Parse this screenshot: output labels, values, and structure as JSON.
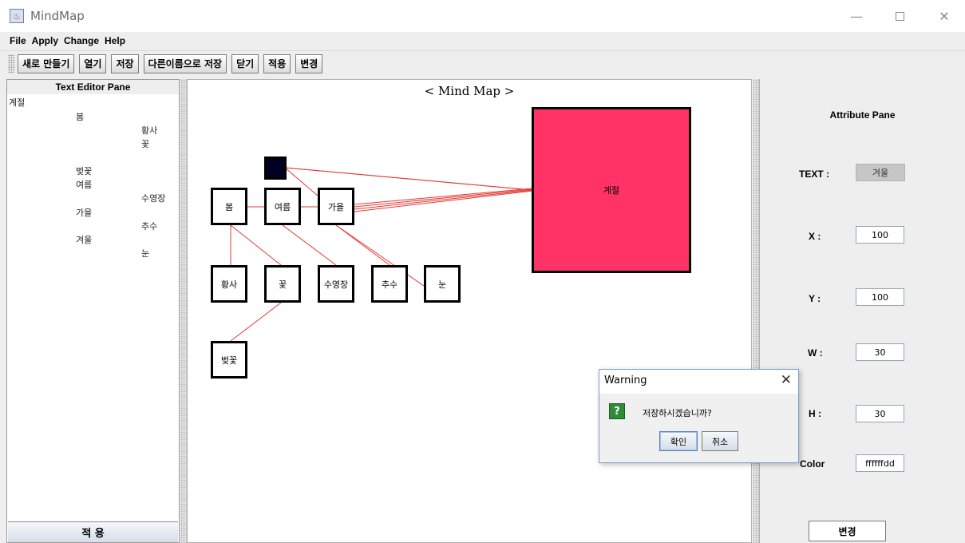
{
  "window": {
    "title": "MindMap",
    "controls": {
      "minimize": "—",
      "maximize": "",
      "close": "✕"
    }
  },
  "menu": {
    "items": [
      "File",
      "Apply",
      "Change",
      "Help"
    ]
  },
  "toolbar": {
    "buttons": [
      "새로 만들기",
      "열기",
      "저장",
      "다른이름으로 저장",
      "닫기",
      "적용",
      "변경"
    ]
  },
  "text_editor": {
    "header": "Text Editor Pane",
    "lines": [
      "계절",
      "봄",
      "황사",
      "꽃",
      "벚꽃",
      "여름",
      "수영장",
      "가을",
      "추수",
      "겨울",
      "눈"
    ],
    "apply_label": "적 용"
  },
  "mind_map": {
    "title": "< Mind Map >",
    "nodes": [
      "계절",
      "",
      "봄",
      "여름",
      "가을",
      "황사",
      "꽃",
      "수영장",
      "추수",
      "눈",
      "벚꽃"
    ],
    "colors": {
      "root_fill": "#ff3366",
      "selected_fill": "#000022",
      "edge": "#e53935"
    }
  },
  "attributes": {
    "title": "Attribute Pane",
    "text_label": "TEXT :",
    "text_value": "겨울",
    "x_label": "X :",
    "x_value": "100",
    "y_label": "Y :",
    "y_value": "100",
    "w_label": "W :",
    "w_value": "30",
    "h_label": "H :",
    "h_value": "30",
    "color_label": "Color",
    "color_value": "ffffffdd",
    "change_label": "변경"
  },
  "dialog": {
    "title": "Warning",
    "icon": "?",
    "message": "저장하시겠습니까?",
    "ok_label": "확인",
    "cancel_label": "취소",
    "close": "✕"
  }
}
